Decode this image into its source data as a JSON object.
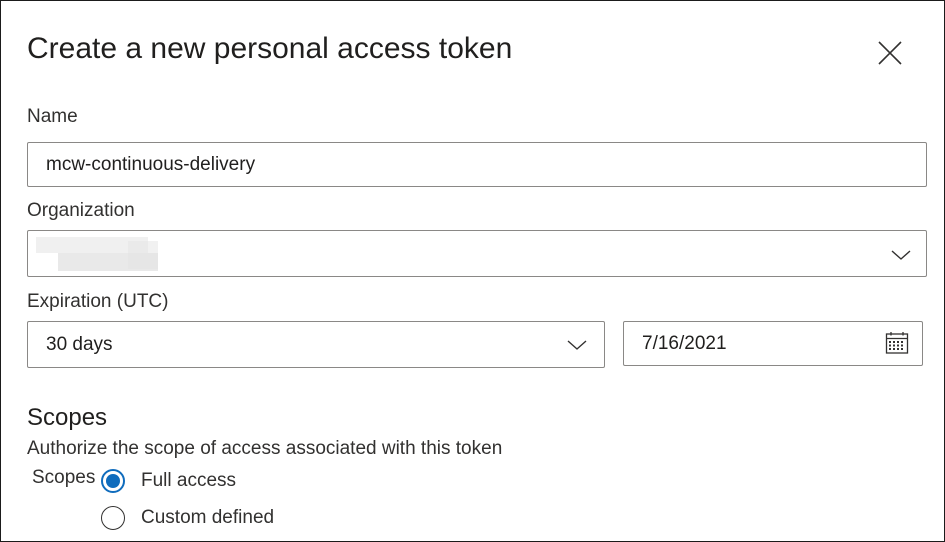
{
  "dialog": {
    "title": "Create a new personal access token",
    "close_icon": "close-icon"
  },
  "name": {
    "label": "Name",
    "value": "mcw-continuous-delivery"
  },
  "organization": {
    "label": "Organization",
    "value": ""
  },
  "expiration": {
    "label": "Expiration (UTC)",
    "selected": "30 days",
    "date": "7/16/2021"
  },
  "scopes": {
    "title": "Scopes",
    "description": "Authorize the scope of access associated with this token",
    "group_label": "Scopes",
    "options": [
      {
        "label": "Full access",
        "checked": true
      },
      {
        "label": "Custom defined",
        "checked": false
      }
    ]
  },
  "colors": {
    "accent": "#0f6cbd",
    "border": "#8a8886"
  }
}
